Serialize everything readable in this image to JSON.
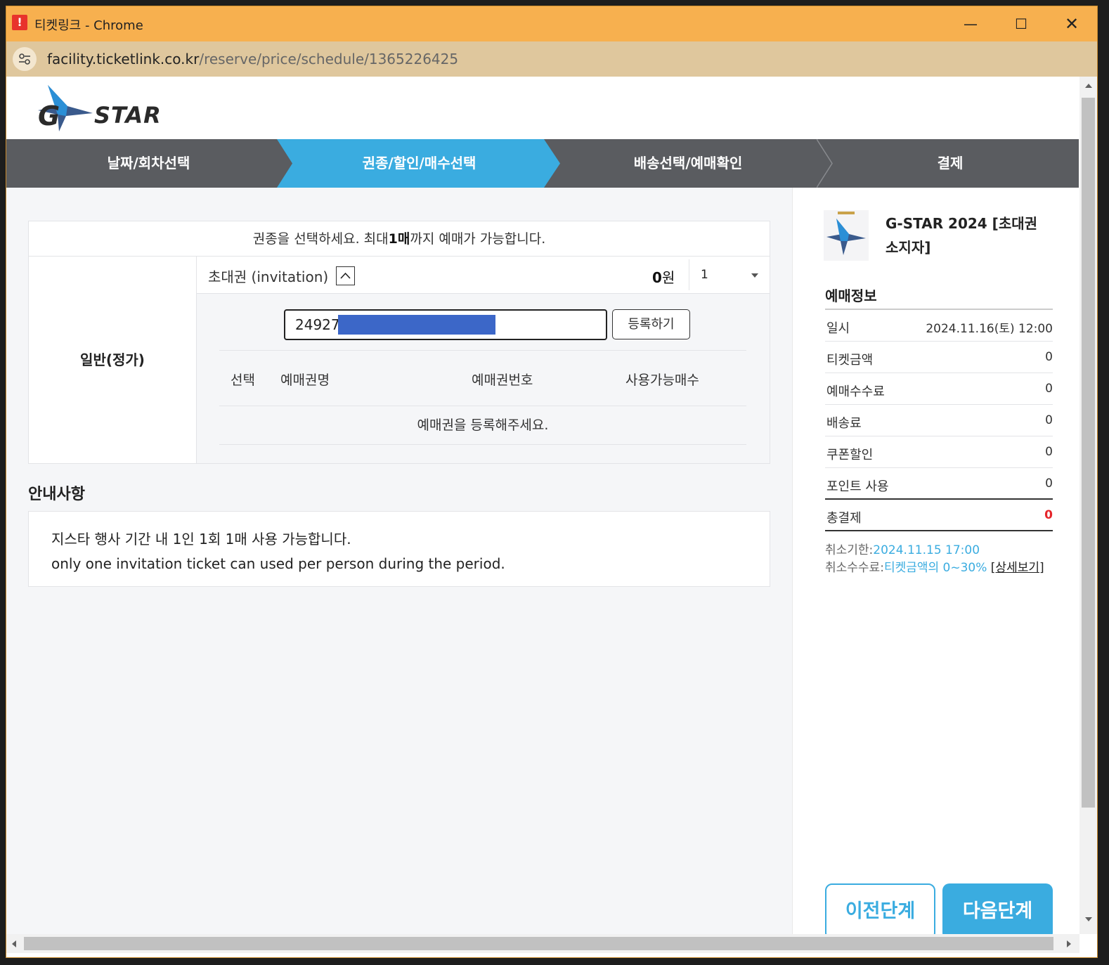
{
  "window": {
    "app_icon": "ticketlink-icon",
    "title": "티켓링크 - Chrome",
    "minimize": "—",
    "maximize": "☐",
    "close": "✕"
  },
  "address": {
    "host": "facility.ticketlink.co.kr",
    "path": "/reserve/price/schedule/1365226425"
  },
  "logo": {
    "g": "G",
    "text": "STAR"
  },
  "steps": [
    {
      "label": "날짜/회차선택",
      "active": false
    },
    {
      "label": "권종/할인/매수선택",
      "active": true
    },
    {
      "label": "배송선택/예매확인",
      "active": false
    },
    {
      "label": "결제",
      "active": false
    }
  ],
  "ticket": {
    "header_before": "권종을 선택하세요. 최대",
    "header_bold": "1매",
    "header_after": "까지 예매가 가능합니다.",
    "type": "일반(정가)",
    "price_name": "초대권 (invitation)",
    "price_amount_bold": "0",
    "price_amount_unit": "원",
    "qty": "1",
    "coupon_value": "24927",
    "register_label": "등록하기",
    "columns": [
      "선택",
      "예매권명",
      "예매권번호",
      "사용가능매수"
    ],
    "empty_message": "예매권을 등록해주세요."
  },
  "notice": {
    "title": "안내사항",
    "line1": "지스타 행사 기간 내 1인 1회 1매 사용 가능합니다.",
    "line2": "only one invitation ticket can used per person during the period."
  },
  "summary": {
    "event_title": "G-STAR 2024 [초대권 소지자]",
    "info_title": "예매정보",
    "rows": [
      {
        "key": "일시",
        "value": "2024.11.16(토) 12:00"
      },
      {
        "key": "티켓금액",
        "value": "0"
      },
      {
        "key": "예매수수료",
        "value": "0"
      },
      {
        "key": "배송료",
        "value": "0"
      },
      {
        "key": "쿠폰할인",
        "value": "0"
      },
      {
        "key": "포인트 사용",
        "value": "0"
      },
      {
        "key": "총결제",
        "value": "0"
      }
    ],
    "cancel_deadline_label": "취소기한:",
    "cancel_deadline_value": "2024.11.15 17:00",
    "cancel_fee_label": "취소수수료:",
    "cancel_fee_value": "티켓금액의 0~30%",
    "detail_link": "[상세보기]",
    "prev_button": "이전단계",
    "next_button": "다음단계"
  },
  "colors": {
    "accent": "#3aace0",
    "total": "#e5252a",
    "titlebar": "#f7b04f",
    "steps_bg": "#5a5c60"
  }
}
